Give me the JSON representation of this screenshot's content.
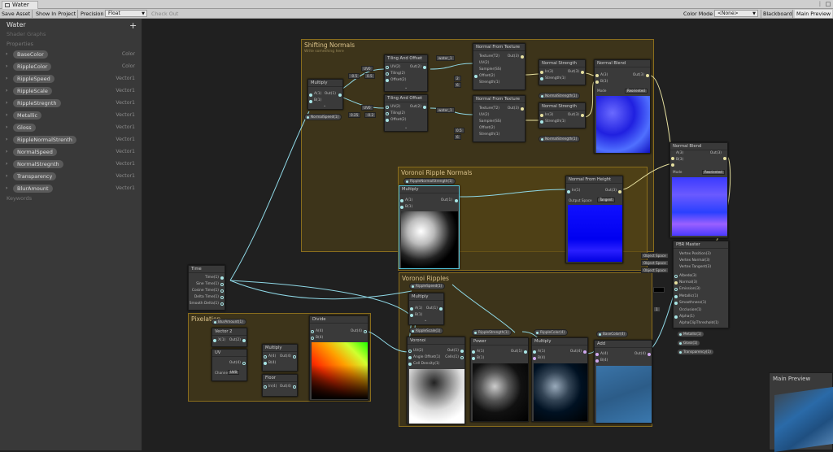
{
  "window": {
    "tab_title": "Water"
  },
  "toolbar": {
    "save_asset": "Save Asset",
    "show_in_project": "Show In Project",
    "precision_label": "Precision",
    "precision_value": "Float",
    "check_out": "Check Out",
    "color_mode_label": "Color Mode",
    "color_mode_value": "<None>",
    "blackboard": "Blackboard",
    "main_preview": "Main Preview"
  },
  "blackboard": {
    "title": "Water",
    "subtitle": "Shader Graphs",
    "properties_label": "Properties",
    "keywords_label": "Keywords",
    "properties": [
      {
        "name": "BaseColor",
        "type": "Color"
      },
      {
        "name": "RippleColor",
        "type": "Color"
      },
      {
        "name": "RippleSpeed",
        "type": "Vector1"
      },
      {
        "name": "RippleScale",
        "type": "Vector1"
      },
      {
        "name": "RippleStregnth",
        "type": "Vector1"
      },
      {
        "name": "Metallic",
        "type": "Vector1"
      },
      {
        "name": "Gloss",
        "type": "Vector1"
      },
      {
        "name": "RippleNormalStrenth",
        "type": "Vector1"
      },
      {
        "name": "NormalSpeed",
        "type": "Vector1"
      },
      {
        "name": "NormalStregnth",
        "type": "Vector1"
      },
      {
        "name": "Transparency",
        "type": "Vector1"
      },
      {
        "name": "BlurAmount",
        "type": "Vector1"
      }
    ]
  },
  "groups": {
    "shifting": {
      "title": "Shifting Normals",
      "subtitle": "Write something here"
    },
    "voronoi_normals": {
      "title": "Voronoi Ripple Normals"
    },
    "voronoi_ripples": {
      "title": "Voronoi Ripples"
    },
    "pixelation": {
      "title": "Pixelation"
    }
  },
  "nodes": {
    "multiply": "Multiply",
    "tiling_offset": "Tiling And Offset",
    "normal_from_texture": "Normal From Texture",
    "normal_strength": "Normal Strength",
    "normal_blend": "Normal Blend",
    "normal_from_height": "Normal From Height",
    "time": "Time",
    "divide": "Divide",
    "vector2": "Vector 2",
    "uv": "UV",
    "floor": "Floor",
    "voronoi": "Voronoi",
    "power": "Power",
    "add": "Add",
    "pbr_master": "PBR Master"
  },
  "ports": {
    "a1": "A(1)",
    "b1": "B(1)",
    "out1": "Out(1)",
    "a2": "A(2)",
    "b2": "B(2)",
    "out2": "Out(2)",
    "a3": "A(3)",
    "b3": "B(3)",
    "out3": "Out(3)",
    "a4": "A(4)",
    "b4": "B(4)",
    "out4": "Out(4)",
    "uv2": "UV(2)",
    "tiling2": "Tiling(2)",
    "offset2": "Offset(2)",
    "texture_t2": "Texture(T2)",
    "sampler_ss": "Sampler(SS)",
    "strength1": "Strength(1)",
    "in3": "In(3)",
    "in1": "In(1)",
    "in4": "In(4)",
    "x1": "X(1)",
    "cells1": "Cells(1)",
    "angle_offset": "Angle Offset(1)",
    "cell_density": "Cell Density(1)",
    "time1": "Time(1)",
    "sine_time": "Sine Time(1)",
    "cosine_time": "Cosine Time(1)",
    "delta_time": "Delta Time(1)",
    "smooth_delta": "Smooth Delta(1)",
    "vertex_position": "Vertex Position(3)",
    "vertex_normal": "Vertex Normal(3)",
    "vertex_tangent": "Vertex Tangent(3)",
    "albedo": "Albedo(3)",
    "normal3": "Normal(3)",
    "emission": "Emission(3)",
    "metallic1": "Metallic(1)",
    "smoothness": "Smoothness(1)",
    "occlusion": "Occlusion(1)",
    "alpha": "Alpha(1)",
    "alpha_clip": "AlphaClipThreshold(1)"
  },
  "labels": {
    "mode": "Mode",
    "reoriented": "Reoriented",
    "output_space": "Output Space",
    "tangent": "Tangent",
    "channel": "Channel",
    "uv0": "UV0",
    "uv0_btn": "UV0",
    "object_space": "Object Space",
    "water_tex": "water_1",
    "x_lbl": "X",
    "y_lbl": "Y",
    "num_neg05": "-0.5",
    "num_05": "0.5",
    "num_025": "0.25",
    "num_neg02": "-0.2",
    "num_2": "2",
    "num_6": "6",
    "num_1": "1"
  },
  "pills": {
    "normal_speed": "NormalSpeed(1)",
    "normal_strength_a": "NormalStrength(1)",
    "normal_strength_b": "NormalStrength(1)",
    "ripple_normal_strength": "RippleNormalStrength(1)",
    "ripple_speed": "RippleSpeed(1)",
    "ripple_scale": "RippleScale(1)",
    "ripple_strength": "RippleStrength(1)",
    "ripple_color": "RippleColor(4)",
    "base_color": "BaseColor(4)",
    "blur_amount": "BlurAmount(1)",
    "metallic": "Metallic(1)",
    "gloss": "Gloss(1)",
    "transparency": "Transparency(1)"
  },
  "main_preview_panel": {
    "title": "Main Preview"
  },
  "colors": {
    "group_border": "#8a6d1d",
    "wire": "#8fd8e6",
    "selection": "#55c8e0"
  }
}
